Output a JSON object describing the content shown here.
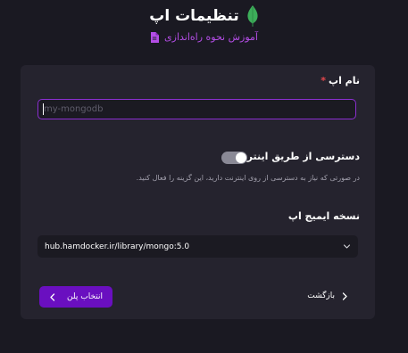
{
  "header": {
    "title": "تنظیمات اپ",
    "guide_link": "آموزش نحوه راه‌اندازی"
  },
  "form": {
    "app_name": {
      "label": "نام اپ",
      "required_mark": "*",
      "value": "",
      "placeholder": "my-mongodb"
    },
    "internet_access": {
      "label": "دسترسی از طریق اینترنت",
      "enabled": false,
      "hint": "در صورتی که نیاز به دسترسی از روی اینترنت دارید، این گزینه را فعال کنید."
    },
    "app_image": {
      "label": "نسخه ایمیج اپ",
      "selected": "hub.hamdocker.ir/library/mongo:5.0"
    }
  },
  "actions": {
    "back_label": "بازگشت",
    "next_label": "انتخاب پلن"
  },
  "colors": {
    "background": "#1a1922",
    "card": "#25232e",
    "accent": "#6a0fc0",
    "link": "#b44de6",
    "leaf": "#3dae5a",
    "required": "#e5484d"
  },
  "icons": {
    "logo": "mongodb-leaf-icon",
    "guide": "document-icon",
    "select": "chevron-down-icon",
    "back": "chevron-right-icon",
    "next": "chevron-left-icon"
  }
}
